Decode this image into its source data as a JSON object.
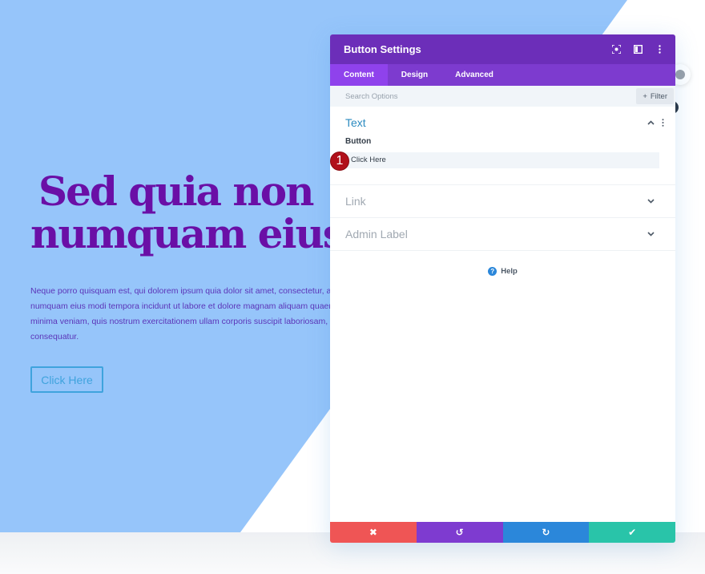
{
  "hero": {
    "title_line1": "Sed quia non",
    "title_line2": "numquam eius",
    "body_lines": [
      "Neque porro quisquam est, qui dolorem ipsum quia dolor sit amet, consectetur, adipisci velit, sed quia non",
      "numquam eius modi tempora incidunt ut labore et dolore magnam aliquam quaerat voluptatem. Ut enim ad",
      "minima veniam, quis nostrum exercitationem ullam corporis suscipit laboriosam, nisi ut aliquid ex ea commodi",
      "consequatur."
    ],
    "button_label": "Click Here"
  },
  "colors": {
    "background_shape": "#96c5fa",
    "title": "#6a0fa6",
    "header": "#6c2eb9",
    "tabs": "#7d3bcf",
    "active_tab": "#8f42ec",
    "discard": "#ef5555",
    "undo": "#7e3bd0",
    "redo": "#2b87da",
    "save": "#29c4a9"
  },
  "panel": {
    "title": "Button Settings",
    "header_icons": [
      "focus-icon",
      "sidebar-layout-icon",
      "more-vertical-icon"
    ],
    "tabs": [
      {
        "label": "Content",
        "active": true
      },
      {
        "label": "Design",
        "active": false
      },
      {
        "label": "Advanced",
        "active": false
      }
    ],
    "search": {
      "placeholder": "Search Options",
      "value": ""
    },
    "filter_label": "Filter",
    "filter_icon": "+",
    "sections": [
      {
        "title": "Text",
        "open": true
      },
      {
        "title": "Link",
        "open": false
      },
      {
        "title": "Admin Label",
        "open": false
      }
    ],
    "text_section": {
      "field_label": "Button",
      "field_value": "Click Here"
    },
    "step_badge": "1",
    "help_label": "Help",
    "help_icon": "?",
    "actions": [
      {
        "name": "discard",
        "icon": "✖"
      },
      {
        "name": "undo",
        "icon": "↺"
      },
      {
        "name": "redo",
        "icon": "↻"
      },
      {
        "name": "save",
        "icon": "✔"
      }
    ]
  }
}
